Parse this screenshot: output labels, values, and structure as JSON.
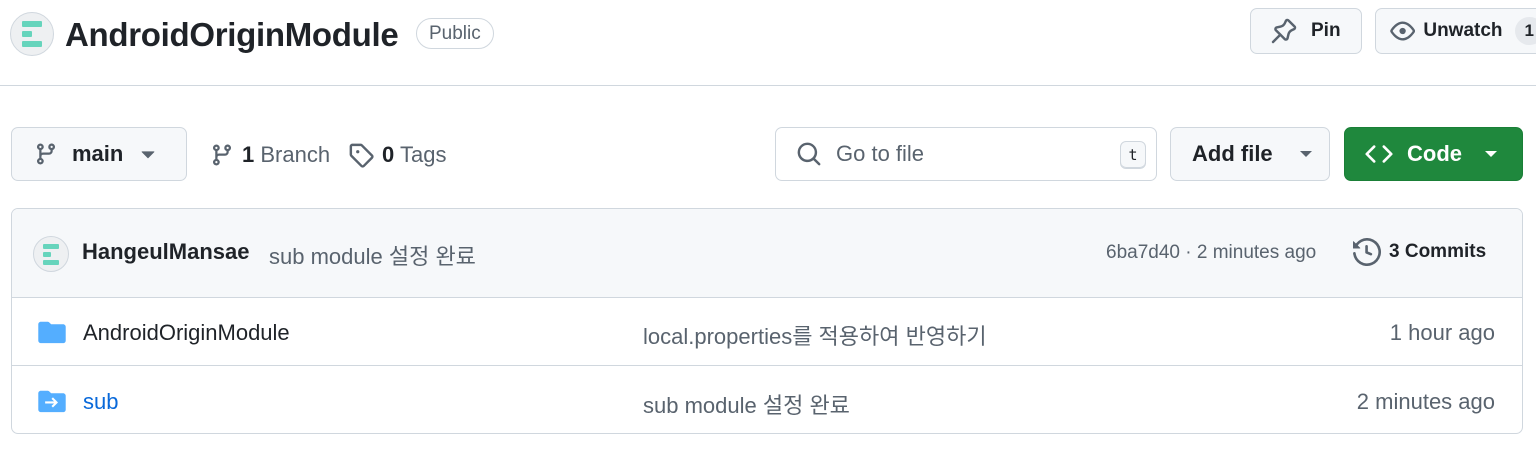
{
  "repo": {
    "name": "AndroidOriginModule",
    "visibility": "Public",
    "pin_label": "Pin",
    "unwatch_label": "Unwatch",
    "watch_count": "1"
  },
  "toolbar": {
    "branch": "main",
    "branches_count": "1",
    "branches_label": "Branch",
    "tags_count": "0",
    "tags_label": "Tags",
    "search_placeholder": "Go to file",
    "search_shortcut": "t",
    "add_file_label": "Add file",
    "code_label": "Code"
  },
  "latest_commit": {
    "author": "HangeulMansae",
    "message": "sub module 설정 완료",
    "meta": "6ba7d40 · 2 minutes ago",
    "commits_label": "3 Commits"
  },
  "files": [
    {
      "name": "AndroidOriginModule",
      "type": "folder-icon",
      "message": "local.properties를 적용하여 반영하기",
      "age": "1 hour ago"
    },
    {
      "name": "sub",
      "type": "submodule-icon",
      "message": "sub module 설정 완료",
      "age": "2 minutes ago"
    }
  ],
  "colors": {
    "primary_button": "#1f883d",
    "link": "#0969da",
    "folder": "#54aeff",
    "avatar_accent": "#66d4bc"
  }
}
